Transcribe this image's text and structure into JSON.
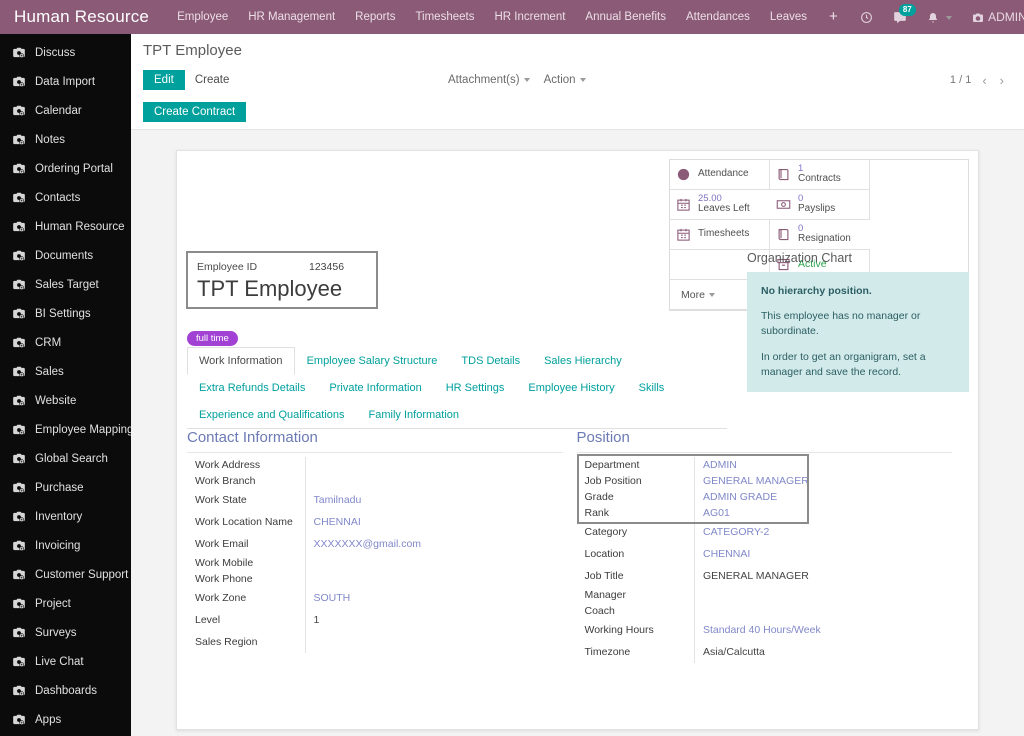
{
  "topbar": {
    "brand": "Human Resource",
    "nav": [
      "Employee",
      "HR Management",
      "Reports",
      "Timesheets",
      "HR Increment",
      "Annual Benefits",
      "Attendances",
      "Leaves"
    ],
    "plus": "+",
    "messages_badge": "87",
    "user": "ADMINISTRATOR",
    "icons": [
      "clock-icon",
      "messages-icon",
      "bell-icon",
      "activity-icon"
    ],
    "accent": "#8b5a77"
  },
  "sidebar": {
    "items": [
      "Discuss",
      "Data Import",
      "Calendar",
      "Notes",
      "Ordering Portal",
      "Contacts",
      "Human Resource",
      "Documents",
      "Sales Target",
      "BI Settings",
      "CRM",
      "Sales",
      "Website",
      "Employee Mapping",
      "Global Search",
      "Purchase",
      "Inventory",
      "Invoicing",
      "Customer Support",
      "Project",
      "Surveys",
      "Live Chat",
      "Dashboards",
      "Apps"
    ]
  },
  "control_panel": {
    "title": "TPT Employee",
    "edit_label": "Edit",
    "create_label": "Create",
    "attachments_label": "Attachment(s)",
    "action_label": "Action",
    "pager": "1 / 1",
    "prev": "‹",
    "next": "›",
    "create_contract_label": "Create Contract",
    "accent": "#00a09d"
  },
  "stat_buttons": [
    {
      "value": "",
      "label": "Attendance",
      "icon": "circle-icon"
    },
    {
      "value": "1",
      "label": "Contracts",
      "icon": "book-icon"
    },
    {
      "value": "25.00",
      "label": "Leaves Left",
      "icon": "calendar-icon"
    },
    {
      "value": "0",
      "label": "Payslips",
      "icon": "money-icon"
    },
    {
      "value": "",
      "label": "Timesheets",
      "icon": "calendar-icon"
    },
    {
      "value": "0",
      "label": "Resignation",
      "icon": "book-icon"
    },
    {
      "value": "",
      "label": "",
      "icon": ""
    },
    {
      "value": "Active",
      "label": "",
      "icon": "archive-icon"
    },
    {
      "value": "",
      "label": "More",
      "icon": ""
    }
  ],
  "employee": {
    "id_label": "Employee ID",
    "id_value": "123456",
    "name": "TPT Employee",
    "tag": "full time"
  },
  "org_chart": {
    "title": "Organization Chart",
    "line1": "No hierarchy position.",
    "line2": "This employee has no manager or subordinate.",
    "line3": "In order to get an organigram, set a manager and save the record."
  },
  "tabs": [
    {
      "label": "Work Information",
      "active": true
    },
    {
      "label": "Employee Salary Structure",
      "active": false
    },
    {
      "label": "TDS Details",
      "active": false
    },
    {
      "label": "Sales Hierarchy",
      "active": false
    },
    {
      "label": "Extra Refunds Details",
      "active": false
    },
    {
      "label": "Private Information",
      "active": false
    },
    {
      "label": "HR Settings",
      "active": false
    },
    {
      "label": "Employee History",
      "active": false
    },
    {
      "label": "Skills",
      "active": false
    },
    {
      "label": "Experience and Qualifications",
      "active": false
    },
    {
      "label": "Family Information",
      "active": false
    }
  ],
  "contact_information": {
    "title": "Contact Information",
    "fields": [
      {
        "label": "Work Address",
        "value": "",
        "style": "empty"
      },
      {
        "label": "Work Branch",
        "value": "",
        "style": "empty"
      },
      {
        "label": "Work State",
        "value": "Tamilnadu",
        "style": "link"
      },
      {
        "label": "Work Location Name",
        "value": "CHENNAI",
        "style": "link"
      },
      {
        "label": "Work Email",
        "value": "XXXXXXX@gmail.com",
        "style": "link"
      },
      {
        "label": "Work Mobile",
        "value": "",
        "style": "empty"
      },
      {
        "label": "Work Phone",
        "value": "",
        "style": "empty"
      },
      {
        "label": "Work Zone",
        "value": "SOUTH",
        "style": "link"
      },
      {
        "label": "Level",
        "value": "1",
        "style": "plain"
      },
      {
        "label": "Sales Region",
        "value": "",
        "style": "empty"
      }
    ]
  },
  "position": {
    "title": "Position",
    "fields": [
      {
        "label": "Department",
        "value": "ADMIN",
        "style": "link"
      },
      {
        "label": "Job Position",
        "value": "GENERAL MANAGER",
        "style": "link"
      },
      {
        "label": "Grade",
        "value": "ADMIN GRADE",
        "style": "link"
      },
      {
        "label": "Rank",
        "value": "AG01",
        "style": "link"
      },
      {
        "label": "Category",
        "value": "CATEGORY-2",
        "style": "link"
      },
      {
        "label": "Location",
        "value": "CHENNAI",
        "style": "link"
      },
      {
        "label": "Job Title",
        "value": "GENERAL MANAGER",
        "style": "plain"
      },
      {
        "label": "Manager",
        "value": "",
        "style": "empty"
      },
      {
        "label": "Coach",
        "value": "",
        "style": "empty"
      },
      {
        "label": "Working Hours",
        "value": "Standard 40 Hours/Week",
        "style": "link"
      },
      {
        "label": "Timezone",
        "value": "Asia/Calcutta",
        "style": "plain"
      }
    ]
  }
}
